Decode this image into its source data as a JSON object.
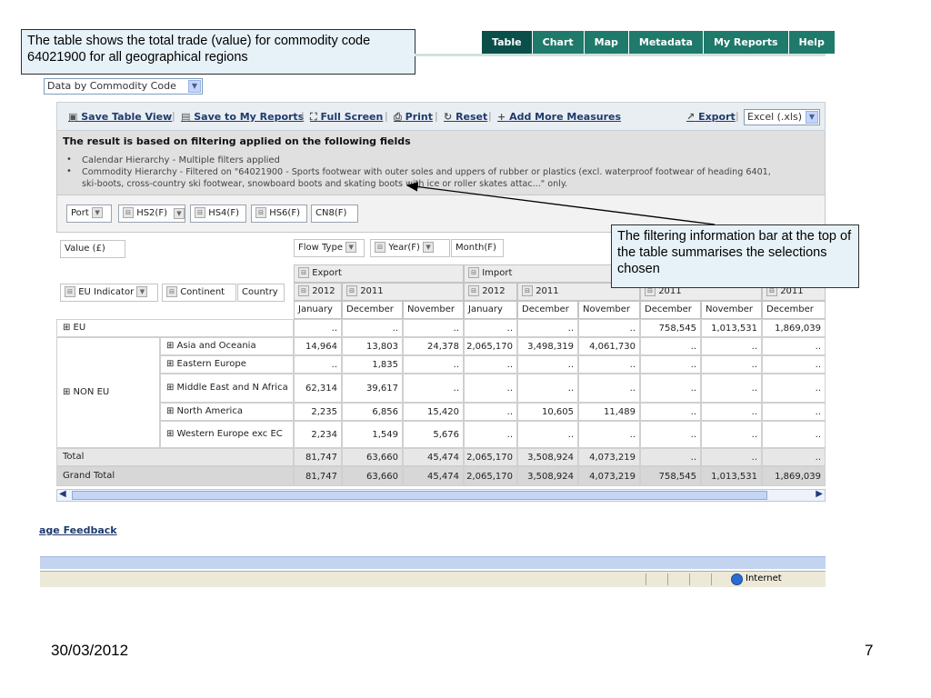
{
  "callouts": {
    "top": "The table shows the total trade (value) for commodity code 64021900 for all geographical regions",
    "right": "The filtering information bar at the top of the table summarises the selections chosen"
  },
  "nav": {
    "tabs": [
      "Table",
      "Chart",
      "Map",
      "Metadata",
      "My Reports",
      "Help"
    ],
    "active": "Table"
  },
  "dataset_select": "Data by Commodity Code",
  "toolbar": {
    "save_table": "Save Table View",
    "save_reports": "Save to My Reports",
    "full_screen": "Full Screen",
    "print": "Print",
    "reset": "Reset",
    "add_measures": "Add More Measures",
    "export": "Export",
    "export_format": "Excel (.xls)"
  },
  "filter_info": {
    "title": "The result is based on filtering applied on the following fields",
    "line1": "Calendar Hierarchy - Multiple filters applied",
    "line2a": "Commodity Hierarchy - Filtered on \"64021900 - Sports footwear with outer soles and uppers of rubber or plastics (excl. waterproof footwear of heading 6401,",
    "line2b": "ski-boots, cross-country ski footwear, snowboard boots and skating boots with ice or roller skates attac...\" only."
  },
  "dimensions": {
    "port": "Port",
    "hs2": "HS2(F)",
    "hs4": "HS4(F)",
    "hs6": "HS6(F)",
    "cn8": "CN8(F)"
  },
  "grid": {
    "measure": "Value (£)",
    "flow_type": "Flow Type",
    "year": "Year(F)",
    "month": "Month(F)",
    "eu_indicator": "EU Indicator",
    "continent": "Continent",
    "country": "Country",
    "flows": [
      "Export",
      "Import"
    ],
    "years": [
      "2012",
      "2011",
      "2012",
      "2011",
      "2011",
      "2011"
    ],
    "months": [
      "January",
      "December",
      "November",
      "January",
      "December",
      "November",
      "December",
      "November",
      "December"
    ],
    "eu_label": "EU",
    "non_eu_label": "NON EU",
    "eu_values": [
      "..",
      "..",
      "..",
      "..",
      "..",
      "..",
      "758,545",
      "1,013,531",
      "1,869,039"
    ],
    "regions": [
      {
        "name": "Asia and Oceania",
        "values": [
          "14,964",
          "13,803",
          "24,378",
          "2,065,170",
          "3,498,319",
          "4,061,730",
          "..",
          "..",
          ".."
        ]
      },
      {
        "name": "Eastern Europe",
        "values": [
          "..",
          "1,835",
          "..",
          "..",
          "..",
          "..",
          "..",
          "..",
          ".."
        ]
      },
      {
        "name": "Middle East and N Africa",
        "values": [
          "62,314",
          "39,617",
          "..",
          "..",
          "..",
          "..",
          "..",
          "..",
          ".."
        ]
      },
      {
        "name": "North America",
        "values": [
          "2,235",
          "6,856",
          "15,420",
          "..",
          "10,605",
          "11,489",
          "..",
          "..",
          ".."
        ]
      },
      {
        "name": "Western Europe exc EC",
        "values": [
          "2,234",
          "1,549",
          "5,676",
          "..",
          "..",
          "..",
          "..",
          "..",
          ".."
        ]
      }
    ],
    "total_label": "Total",
    "total_values": [
      "81,747",
      "63,660",
      "45,474",
      "2,065,170",
      "3,508,924",
      "4,073,219",
      "..",
      "..",
      ".."
    ],
    "grand_total_label": "Grand Total",
    "grand_total_values": [
      "81,747",
      "63,660",
      "45,474",
      "2,065,170",
      "3,508,924",
      "4,073,219",
      "758,545",
      "1,013,531",
      "1,869,039"
    ]
  },
  "feedback_link": "age Feedback",
  "status_zone": "Internet",
  "slide_footer": {
    "date": "30/03/2012",
    "page": "7"
  }
}
